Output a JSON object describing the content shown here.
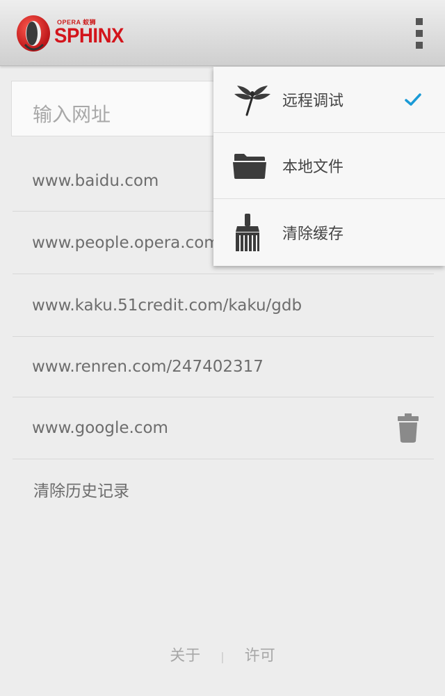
{
  "header": {
    "logo_small": "OPERA 蚁狮",
    "logo_text": "SPHINX",
    "brand_color": "#d3141b"
  },
  "search": {
    "placeholder": "输入网址"
  },
  "history": {
    "items": [
      {
        "url": "www.baidu.com"
      },
      {
        "url": "www.people.opera.com"
      },
      {
        "url": "www.kaku.51credit.com/kaku/gdb"
      },
      {
        "url": "www.renren.com/247402317"
      },
      {
        "url": "www.google.com"
      }
    ],
    "clear_label": "清除历史记录"
  },
  "menu": {
    "items": [
      {
        "label": "远程调试",
        "icon": "dragonfly-icon",
        "checked": true
      },
      {
        "label": "本地文件",
        "icon": "folder-icon",
        "checked": false
      },
      {
        "label": "清除缓存",
        "icon": "broom-icon",
        "checked": false
      }
    ],
    "check_color": "#1a9ad6"
  },
  "footer": {
    "about": "关于",
    "separator": "|",
    "license": "许可"
  }
}
